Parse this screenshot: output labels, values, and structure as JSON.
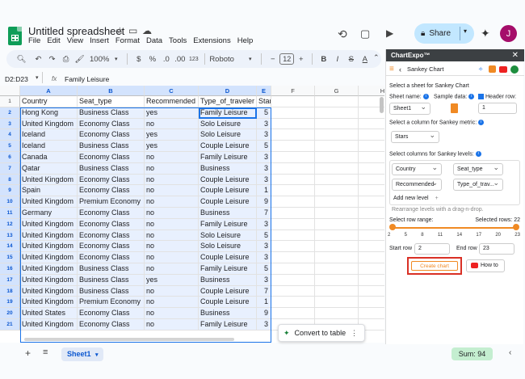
{
  "doc": {
    "title": "Untitled spreadsheet",
    "share_label": "Share",
    "avatar_initial": "J"
  },
  "menu": [
    "File",
    "Edit",
    "View",
    "Insert",
    "Format",
    "Data",
    "Tools",
    "Extensions",
    "Help"
  ],
  "toolbar": {
    "zoom": "100%",
    "currency": "$",
    "percent": "%",
    "dec_less": ".0",
    "dec_more": ".00",
    "number_fmt": "123",
    "font": "Roboto",
    "font_size": "12"
  },
  "formula": {
    "range": "D2:D23",
    "fx": "fx",
    "value": "Family Leisure"
  },
  "columns": [
    "A",
    "B",
    "C",
    "D",
    "E",
    "F",
    "G",
    "H"
  ],
  "rows": [
    [
      "Country",
      "Seat_type",
      "Recommended",
      "Type_of_traveler",
      "Stars"
    ],
    [
      "Hong Kong",
      "Business Class",
      "yes",
      "Family Leisure",
      "5"
    ],
    [
      "United Kingdom",
      "Economy Class",
      "no",
      "Solo Leisure",
      "3"
    ],
    [
      "Iceland",
      "Economy Class",
      "yes",
      "Solo Leisure",
      "3"
    ],
    [
      "Iceland",
      "Business Class",
      "yes",
      "Couple Leisure",
      "5"
    ],
    [
      "Canada",
      "Economy Class",
      "no",
      "Family Leisure",
      "3"
    ],
    [
      "Qatar",
      "Business Class",
      "no",
      "Business",
      "3"
    ],
    [
      "United Kingdom",
      "Economy Class",
      "no",
      "Couple Leisure",
      "3"
    ],
    [
      "Spain",
      "Economy Class",
      "no",
      "Couple Leisure",
      "1"
    ],
    [
      "United Kingdom",
      "Premium Economy",
      "no",
      "Couple Leisure",
      "9"
    ],
    [
      "Germany",
      "Economy Class",
      "no",
      "Business",
      "7"
    ],
    [
      "United Kingdom",
      "Economy Class",
      "no",
      "Family Leisure",
      "3"
    ],
    [
      "United Kingdom",
      "Economy Class",
      "no",
      "Solo Leisure",
      "5"
    ],
    [
      "United Kingdom",
      "Economy Class",
      "no",
      "Solo Leisure",
      "3"
    ],
    [
      "United Kingdom",
      "Economy Class",
      "no",
      "Couple Leisure",
      "3"
    ],
    [
      "United Kingdom",
      "Business Class",
      "no",
      "Family Leisure",
      "5"
    ],
    [
      "United Kingdom",
      "Business Class",
      "yes",
      "Business",
      "3"
    ],
    [
      "United Kingdom",
      "Business Class",
      "no",
      "Couple Leisure",
      "7"
    ],
    [
      "United Kingdom",
      "Premium Economy",
      "no",
      "Couple Leisure",
      "1"
    ],
    [
      "United States",
      "Economy Class",
      "no",
      "Business",
      "9"
    ],
    [
      "United Kingdom",
      "Economy Class",
      "no",
      "Family Leisure",
      "3"
    ]
  ],
  "row_numbers": [
    "1",
    "2",
    "3",
    "4",
    "5",
    "6",
    "7",
    "8",
    "9",
    "10",
    "11",
    "12",
    "13",
    "14",
    "15",
    "16",
    "17",
    "18",
    "19",
    "20",
    "21",
    "22"
  ],
  "convert_label": "Convert to table",
  "sheet_tab": "Sheet1",
  "sum": "Sum: 94",
  "panel": {
    "brand": "ChartExpo™",
    "chart_name": "Sankey Chart",
    "select_sheet": "Select a sheet for Sankey Chart",
    "sheet_name_label": "Sheet name:",
    "sample_label": "Sample data:",
    "header_label": "Header row:",
    "sheet_value": "Sheet1",
    "header_value": "1",
    "metric_label": "Select a column for Sankey metric:",
    "metric_value": "Stars",
    "levels_label": "Select columns for Sankey levels:",
    "levels": [
      "Country",
      "Seat_type",
      "Recommended",
      "Type_of_trav..."
    ],
    "add_level": "Add new level",
    "rearrange": "Rearrange levels with a drag-n-drop.",
    "row_range_label": "Select row range:",
    "selected_rows": "Selected rows: 22",
    "ticks": [
      "2",
      "5",
      "8",
      "11",
      "14",
      "17",
      "20",
      "23"
    ],
    "start_row_label": "Start row",
    "start_row": "2",
    "end_row_label": "End row",
    "end_row": "23",
    "create_label": "Create chart",
    "howto_label": "How to",
    "colors": {
      "accent": "#f08a24",
      "red": "#d93025"
    }
  }
}
